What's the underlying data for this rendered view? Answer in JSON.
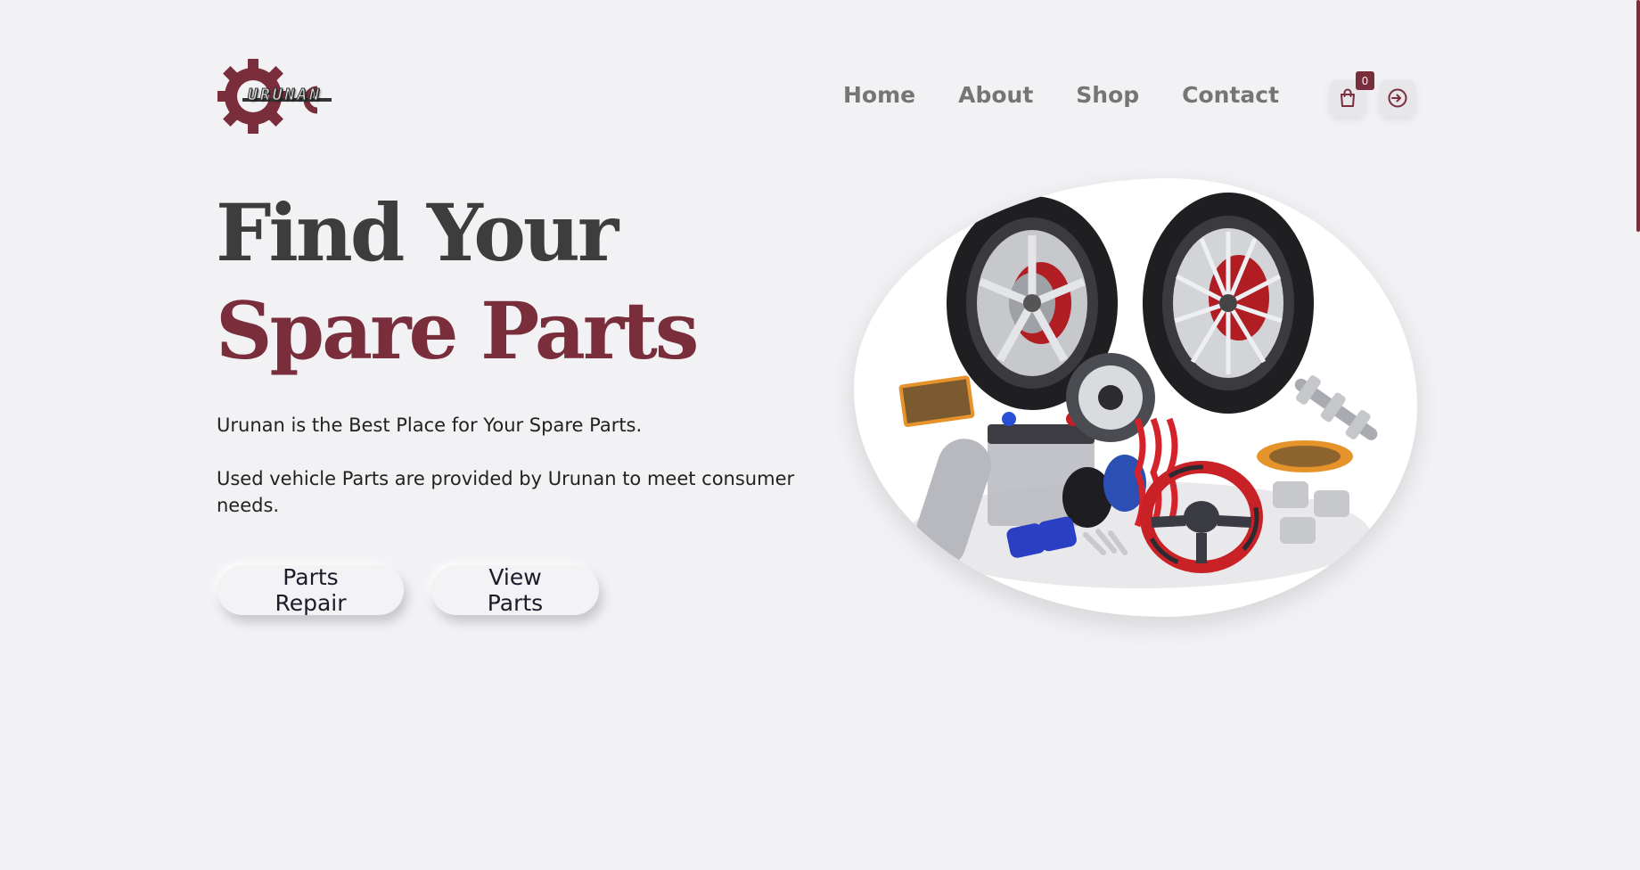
{
  "brand": {
    "name": "URUNAN",
    "accent_color": "#7a2e3b"
  },
  "nav": {
    "items": [
      {
        "label": "Home"
      },
      {
        "label": "About"
      },
      {
        "label": "Shop"
      },
      {
        "label": "Contact"
      }
    ]
  },
  "actions": {
    "cart_icon": "shopping-bag-icon",
    "cart_count": "0",
    "login_icon": "sign-in-icon"
  },
  "hero": {
    "title_line1": "Find Your",
    "title_line2": "Spare Parts",
    "description_1": "Urunan is the Best Place for Your Spare Parts.",
    "description_2": "Used vehicle Parts are provided by Urunan to meet consumer needs.",
    "primary_button": "Parts Repair",
    "secondary_button": "View Parts",
    "image_subject": "car-spare-parts-collection"
  },
  "colors": {
    "background": "#f2f1f4",
    "title_dark": "#3d3d3d",
    "title_accent": "#7a2e3b",
    "nav_text": "#757575"
  }
}
